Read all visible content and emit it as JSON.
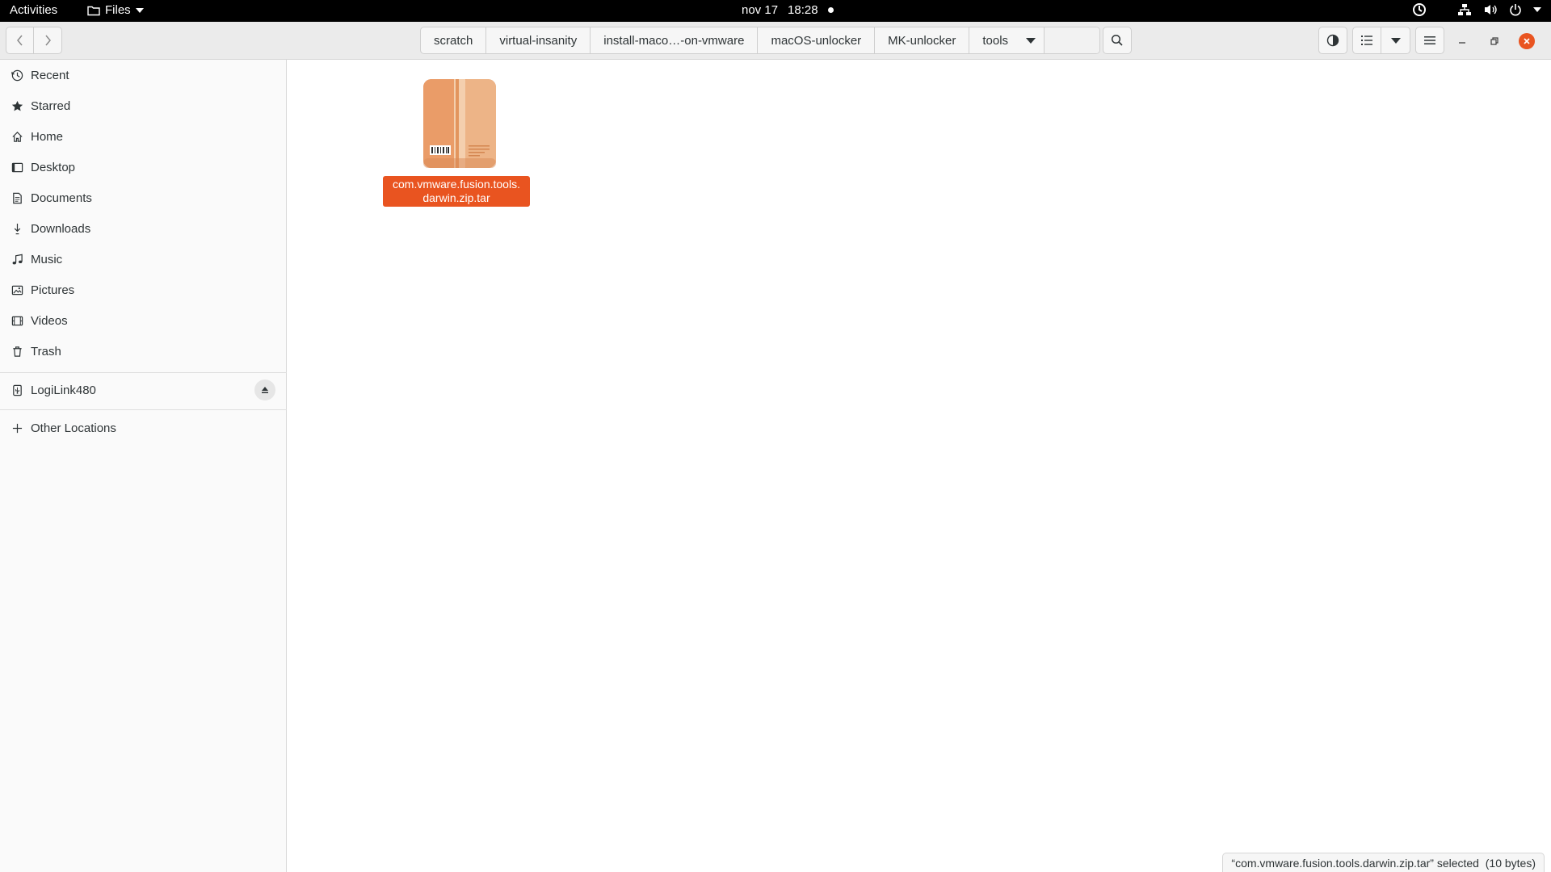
{
  "topbar": {
    "activities": "Activities",
    "app_name": "Files",
    "date": "nov 17",
    "time": "18:28"
  },
  "pathbar": {
    "crumbs": [
      "scratch",
      "virtual-insanity",
      "install-maco…-on-vmware",
      "macOS-unlocker",
      "MK-unlocker"
    ],
    "current": "tools"
  },
  "sidebar": {
    "places": [
      {
        "label": "Recent",
        "icon": "clock-icon"
      },
      {
        "label": "Starred",
        "icon": "star-icon"
      },
      {
        "label": "Home",
        "icon": "home-icon"
      },
      {
        "label": "Desktop",
        "icon": "desktop-icon"
      },
      {
        "label": "Documents",
        "icon": "document-icon"
      },
      {
        "label": "Downloads",
        "icon": "download-icon"
      },
      {
        "label": "Music",
        "icon": "music-icon"
      },
      {
        "label": "Pictures",
        "icon": "picture-icon"
      },
      {
        "label": "Videos",
        "icon": "video-icon"
      },
      {
        "label": "Trash",
        "icon": "trash-icon"
      }
    ],
    "devices": [
      {
        "label": "LogiLink480",
        "icon": "usb-drive-icon"
      }
    ],
    "other": {
      "label": "Other Locations",
      "icon": "plus-icon"
    }
  },
  "files": [
    {
      "name": "com.vmware.fusion.tools.darwin.zip.tar",
      "display_line1": "com.vmware.fusion.tools.",
      "display_line2": "darwin.zip.tar",
      "icon": "archive-package-icon",
      "selected": true
    }
  ],
  "status": {
    "text": "“com.vmware.fusion.tools.darwin.zip.tar” selected  (10 bytes)"
  },
  "colors": {
    "accent": "#e95420",
    "topbar": "#000000",
    "headerbar": "#ebebeb",
    "sidebar": "#fafafa"
  }
}
